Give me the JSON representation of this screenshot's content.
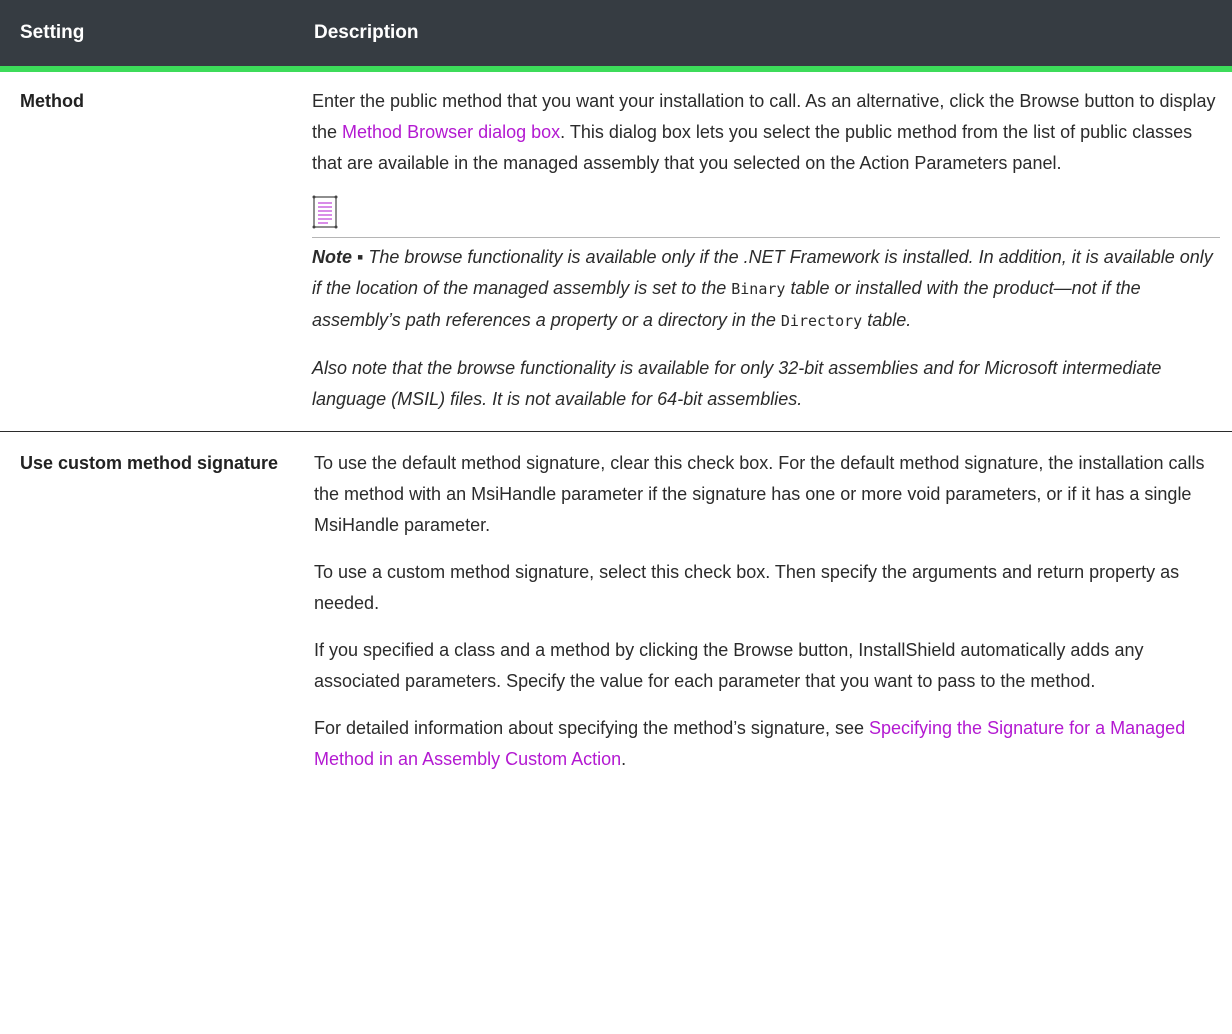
{
  "header": {
    "col_setting": "Setting",
    "col_description": "Description"
  },
  "rows": [
    {
      "setting": "Method",
      "desc_p1_a": "Enter the public method that you want your installation to call. As an alternative, click the Browse button to display the ",
      "desc_p1_link": "Method Browser dialog box",
      "desc_p1_b": ". This dialog box lets you select the public method from the list of public classes that are available in the managed assembly that you selected on the Action Parameters panel.",
      "note_icon": "note-icon",
      "note_label": "Note ▪ ",
      "note_t1": "The browse functionality is available only if the .NET Framework is installed. In addition, it is available only if the location of the managed assembly is set to the ",
      "note_code1": "Binary",
      "note_t2": " table or installed with the product—not if the assembly’s path references a property or a directory in the ",
      "note_code2": "Directory",
      "note_t3": " table.",
      "note_p2": "Also note that the browse functionality is available for only 32-bit assemblies and for Microsoft intermediate language (MSIL) files. It is not available for 64-bit assemblies."
    },
    {
      "setting": "Use custom method signature",
      "p1": "To use the default method signature, clear this check box. For the default method signature, the installation calls the method with an MsiHandle parameter if the signature has one or more void parameters, or if it has a single MsiHandle parameter.",
      "p2": "To use a custom method signature, select this check box. Then specify the arguments and return property as needed.",
      "p3": "If you specified a class and a method by clicking the Browse button, InstallShield automatically adds any associated parameters. Specify the value for each parameter that you want to pass to the method.",
      "p4_a": "For detailed information about specifying the method’s signature, see ",
      "p4_link": "Specifying the Signature for a Managed Method in an Assembly Custom Action",
      "p4_b": "."
    }
  ],
  "colors": {
    "header_bg": "#363c42",
    "header_rule": "#3ddc5a",
    "link": "#b319d1"
  }
}
